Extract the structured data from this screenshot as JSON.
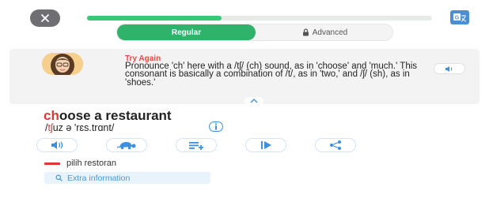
{
  "header": {
    "progress_fraction": 0.39
  },
  "mode_tabs": {
    "regular_label": "Regular",
    "advanced_label": "Advanced"
  },
  "feedback": {
    "status": "Try Again",
    "message": "Pronounce 'ch' here with a /tʃ/ (ch) sound, as in 'choose' and 'much.' This consonant is basically a combination of /t/, as in 'two,' and /ʃ/ (sh), as in 'shoes.'"
  },
  "phrase": {
    "highlight": "ch",
    "rest": "oose a restaurant",
    "ipa_prefix": "/",
    "ipa_highlight": "tʃ",
    "ipa_rest": "uz ə 'rɛs.trɑnt/"
  },
  "translation": {
    "text": "pilih restoran"
  },
  "extra": {
    "label": "Extra information"
  },
  "colors": {
    "accent_green": "#2fb36b",
    "error_red": "#e23535",
    "link_blue": "#3d8fe0"
  },
  "icons": {
    "close": "close-icon",
    "translate": "translate-icon",
    "lock": "lock-icon",
    "speaker": "speaker-icon",
    "slow": "turtle-icon",
    "add_list": "playlist-add-icon",
    "next": "next-icon",
    "share": "share-icon",
    "info": "info-icon",
    "search": "search-icon"
  }
}
